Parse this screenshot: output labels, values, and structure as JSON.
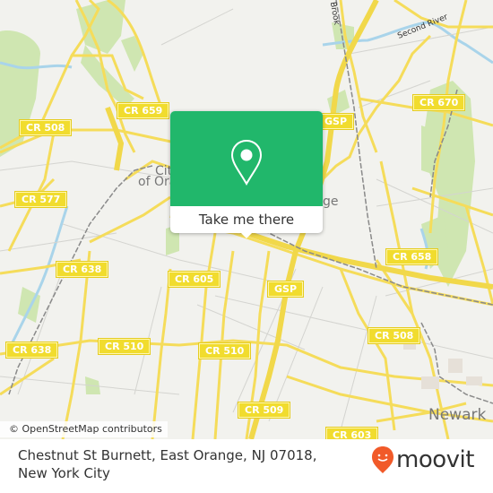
{
  "map": {
    "shields": [
      {
        "label": "CR 659"
      },
      {
        "label": "CR 508"
      },
      {
        "label": "CR 577"
      },
      {
        "label": "CR 638"
      },
      {
        "label": "CR 638"
      },
      {
        "label": "CR 510"
      },
      {
        "label": "CR 605"
      },
      {
        "label": "CR 510"
      },
      {
        "label": "GSP"
      },
      {
        "label": "GSP"
      },
      {
        "label": "CR 670"
      },
      {
        "label": "CR 658"
      },
      {
        "label": "CR 508"
      },
      {
        "label": "CR 509"
      },
      {
        "label": "CR 603"
      }
    ],
    "places": {
      "city_of_orange_line1": "City",
      "city_of_orange_line2": "of Orange",
      "east_orange_fragment": "ge",
      "newark": "Newark"
    },
    "waterways": {
      "second_river": "Second River",
      "brook": "Brook"
    },
    "attribution": "© OpenStreetMap contributors",
    "colors": {
      "background": "#f2f2ee",
      "road": "#f5dc5a",
      "park": "#c8e2a8",
      "water": "#a9d4ea",
      "rail": "#808080"
    }
  },
  "popup": {
    "icon": "map-pin-icon",
    "cta_label": "Take me there",
    "accent_color": "#21b76b"
  },
  "footer": {
    "address": "Chestnut St Burnett, East Orange, NJ 07018, New York City",
    "logo_text": "moovit",
    "logo_icon": "moovit-smiley-pin-icon",
    "logo_color": "#f15a29"
  }
}
